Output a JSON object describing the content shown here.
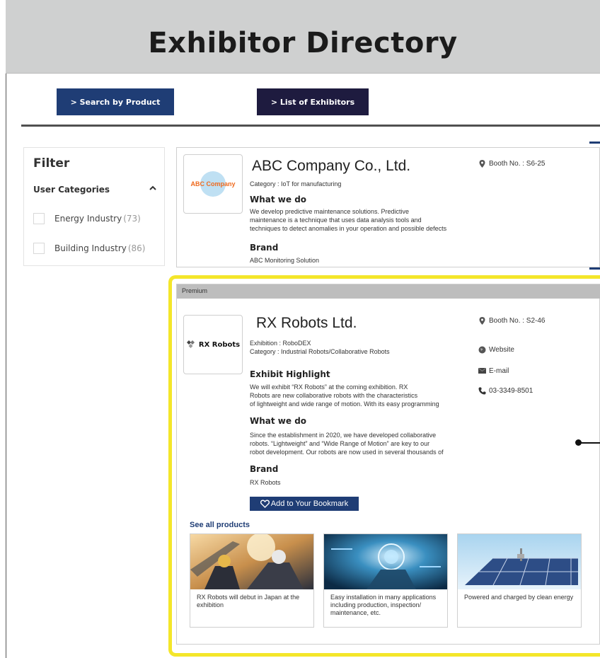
{
  "header": {
    "title": "Exhibitor Directory"
  },
  "nav": {
    "search_label": "> Search by Product",
    "list_label": "> List of Exhibitors"
  },
  "filter": {
    "title": "Filter",
    "category_title": "User Categories",
    "options": [
      {
        "label": "Energy Industry",
        "count": "(73)"
      },
      {
        "label": "Building Industry",
        "count": "(86)"
      }
    ]
  },
  "exhibitors": [
    {
      "logo_text": "ABC Company",
      "name": "ABC Company Co., Ltd.",
      "category": "Category : IoT for manufacturing",
      "what_title": "What we do",
      "what_lines": [
        "We develop predictive maintenance solutions.  Predictive",
        "maintenance is a technique that uses data analysis tools and",
        "techniques to detect anomalies in your operation and possible defects"
      ],
      "brand_title": "Brand",
      "brand": "ABC Monitoring Solution",
      "booth": "Booth No. : S6-25"
    },
    {
      "tier": "Premium",
      "logo_text": "RX Robots",
      "name": "RX Robots Ltd.",
      "exhibition": "Exhibition : RoboDEX",
      "category": "Category : Industrial Robots/Collaborative Robots",
      "highlight_title": "Exhibit Highlight",
      "highlight_lines": [
        "We will exhibit “RX Robots” at the coming exhibition. RX",
        "Robots are new collaborative robots with the characteristics",
        "of lightweight and wide range of motion. With its easy programming"
      ],
      "what_title": "What we do",
      "what_lines": [
        "Since the establishment in 2020, we have developed collaborative",
        "robots. “Lightweight” and “Wide Range of Motion” are key to our",
        "robot development. Our robots are now used in several thousands of"
      ],
      "brand_title": "Brand",
      "brand": "RX Robots",
      "booth": "Booth No. : S2-46",
      "website": "Website",
      "email": "E-mail",
      "phone": "03-3349-8501",
      "bookmark": "Add to Your Bookmark",
      "see_all": "See all products",
      "products": [
        {
          "caption": "RX Robots will debut in Japan at the exhibition"
        },
        {
          "caption": "Easy installation in many applications including production, inspection/ maintenance, etc."
        },
        {
          "caption": "Powered and charged by clean energy"
        }
      ]
    }
  ],
  "colors": {
    "header_bg": "#cfd0d0",
    "nav_search_bg": "#1f3d75",
    "nav_list_bg": "#1e1b3f",
    "premium_border": "#f4e62a",
    "accent": "#1f3d75"
  },
  "icons": [
    "chevron-up-icon",
    "location-pin-icon",
    "globe-icon",
    "mail-icon",
    "phone-icon",
    "heart-icon",
    "rx-diamond-logo-icon"
  ]
}
